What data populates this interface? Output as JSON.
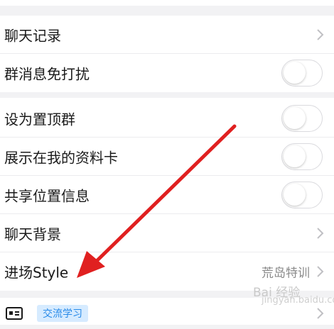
{
  "settings": {
    "chat_history_label": "聊天记录",
    "mute_group_label": "群消息免打扰",
    "pin_group_label": "设为置顶群",
    "show_on_profile_label": "展示在我的资料卡",
    "share_location_label": "共享位置信息",
    "chat_background_label": "聊天背景",
    "entry_style_label": "进场Style",
    "entry_style_value": "荒岛特训"
  },
  "bottom": {
    "tag_label": "交流学习"
  },
  "toggles": {
    "mute_group": false,
    "pin_group": false,
    "show_on_profile": false,
    "share_location": false
  },
  "watermark": {
    "brand": "Bai 经验",
    "sub": "jingyan.baidu.com"
  },
  "colors": {
    "background": "#f2f2f4",
    "row_bg": "#ffffff",
    "arrow": "#e02020",
    "tag_bg": "#d6ebff",
    "tag_text": "#2a8be8"
  }
}
